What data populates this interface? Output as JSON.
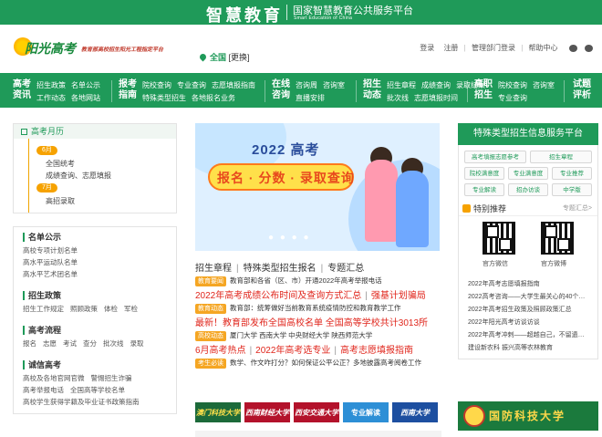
{
  "topbar": {
    "brand": "智慧教育",
    "platform": "国家智慧教育公共服务平台",
    "platform_en": "Smart Education of China"
  },
  "header": {
    "logo_name": "阳光高考",
    "logo_slogan": "教育部高校招生阳光工程指定平台",
    "location": "全国",
    "location_switch": "[更换]",
    "links": [
      "登录",
      "注册",
      "管理部门登录",
      "帮助中心"
    ]
  },
  "nav": [
    {
      "main": "高考资讯",
      "links": [
        "招生政策",
        "名单公示",
        "工作动态",
        "各地网站"
      ]
    },
    {
      "main": "报考指南",
      "links": [
        "院校查询",
        "专业查询",
        "志愿填报指南",
        "特殊类型招生",
        "各地报名业务"
      ]
    },
    {
      "main": "在线咨询",
      "links": [
        "咨询周",
        "咨询室",
        "直播安排"
      ]
    },
    {
      "main": "招生动态",
      "links": [
        "招生章程",
        "成绩查询",
        "录取结果",
        "批次线",
        "志愿填报时间"
      ]
    },
    {
      "main": "高职招生",
      "links": [
        "院校查询",
        "咨询室",
        "专业查询"
      ]
    },
    {
      "main": "试题评析",
      "links": []
    }
  ],
  "calendar": {
    "title": "高考月历",
    "months": [
      {
        "month": "6月",
        "items": [
          "全国统考",
          "成绩查询、志愿填报"
        ]
      },
      {
        "month": "7月",
        "items": [
          "高招录取"
        ]
      }
    ]
  },
  "sections": [
    {
      "title": "名单公示",
      "links": [
        "高校专项计划名单",
        "高水平运动队名单",
        "高水平艺术团名单"
      ]
    },
    {
      "title": "招生政策",
      "links": [
        "招生工作规定",
        "照顾政策",
        "体检",
        "军检"
      ]
    },
    {
      "title": "高考流程",
      "links": [
        "报名",
        "志愿",
        "考试",
        "查分",
        "批次线",
        "录取"
      ]
    },
    {
      "title": "诚信高考",
      "links": [
        "高校及各地官网官微",
        "警惕招生诈骗",
        "高考举报电话",
        "全国高等学校名单",
        "高校学生获得学籍及毕业证书政策指南"
      ]
    }
  ],
  "banner": {
    "year_title": "2022 高考",
    "pill_text": "报名 · 分数 · 录取查询"
  },
  "center": {
    "newshead": [
      "招生章程",
      "特殊类型招生报名",
      "专题汇总"
    ],
    "rows": [
      {
        "tag": "教育要闻",
        "text": "教育部和各省（区、市）开通2022年高考举报电话"
      },
      {
        "headline": [
          "2022年高考成绩公布时间及查询方式汇总",
          "强基计划骗局"
        ]
      },
      {
        "tag": "教育动态",
        "text": "教育部：统筹做好当前教育系统疫情防控和教育教学工作"
      },
      {
        "headline": [
          "最新！教育部发布全国高校名单 全国高等学校共计3013所"
        ]
      },
      {
        "tag": "高校动态",
        "text": "厦门大学  西南大学  中央财经大学  陕西师范大学"
      },
      {
        "headline": [
          "6月高考热点",
          "2022年高考选专业",
          "高考志愿填报指南"
        ]
      },
      {
        "tag": "考生必读",
        "text": "数学、作文咋打分？如何保证公平公正？多地披露高考阅卷工作"
      }
    ],
    "logos": [
      "澳门科技大学",
      "西南财经大学",
      "西安交通大学",
      "专业解读",
      "西南大学"
    ]
  },
  "right": {
    "header": "特殊类型招生信息服务平台",
    "buttons": [
      "高考填报志愿参考",
      "招生章程",
      "院校满意度",
      "专业满意度",
      "专业推荐",
      "专业解读",
      "招办访谈",
      "中学版"
    ],
    "rec_title": "特别推荐",
    "rec_more": "专题汇总>",
    "qr_labels": [
      "官方微信",
      "官方微博"
    ],
    "list": [
      "2022年高考志愿填报指南",
      "2022高考咨询——大学生最关心的40个…",
      "2022年高考招生政策及照顾政策汇总",
      "2022年阳光高考访谈访谈",
      "2022年高考冲刺——超越自己，不留遗…",
      "建设新农科 振兴高等农林教育"
    ],
    "banner": "国防科技大学"
  },
  "colors": {
    "brand_green": "#1f9a59",
    "accent_red": "#e0261c",
    "tag_orange": "#f5a623"
  }
}
